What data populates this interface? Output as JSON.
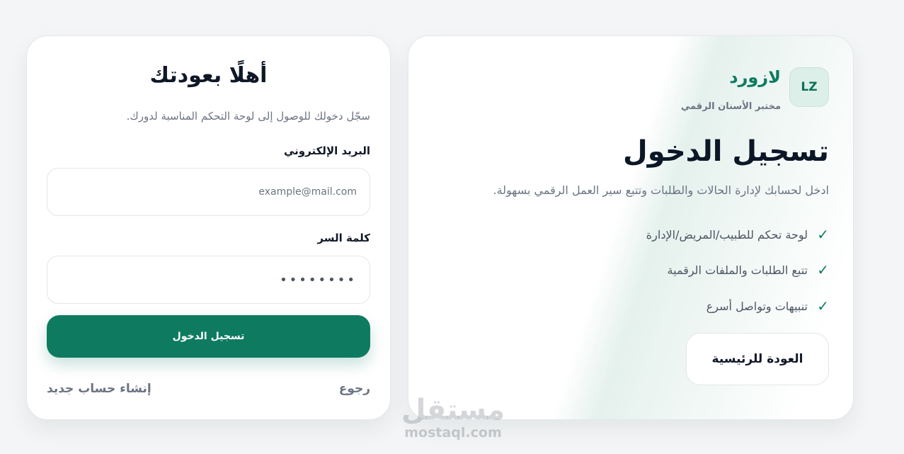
{
  "login": {
    "title": "أهلًا بعودتك",
    "subtitle": "سجّل دخولك للوصول إلى لوحة التحكم المناسبة لدورك.",
    "email_label": "البريد الإلكتروني",
    "email_placeholder": "example@mail.com",
    "password_label": "كلمة السر",
    "password_value": "********",
    "submit_label": "تسجيل الدخول",
    "back_link": "رجوع",
    "register_link": "إنشاء حساب جديد"
  },
  "brand": {
    "logo_text": "LZ",
    "name": "لازورد",
    "tagline": "مختبر الأسنان الرقمي"
  },
  "info": {
    "title": "تسجيل الدخول",
    "subtitle": "ادخل لحسابك لإدارة الحالات والطلبات وتتبع سير العمل الرقمي بسهولة.",
    "features": [
      "لوحة تحكم للطبيب/المريض/الإدارة",
      "تتبع الطلبات والملفات الرقمية",
      "تنبيهات وتواصل أسرع"
    ],
    "home_button": "العودة للرئيسية"
  },
  "watermark": {
    "logo_text": "مستقل",
    "url": "mostaql.com"
  },
  "icons": {
    "check": "check-icon"
  },
  "colors": {
    "accent": "#0e7b61",
    "title_text": "#0b1626",
    "muted_text": "#6b7483",
    "background": "#f4f5f6"
  }
}
